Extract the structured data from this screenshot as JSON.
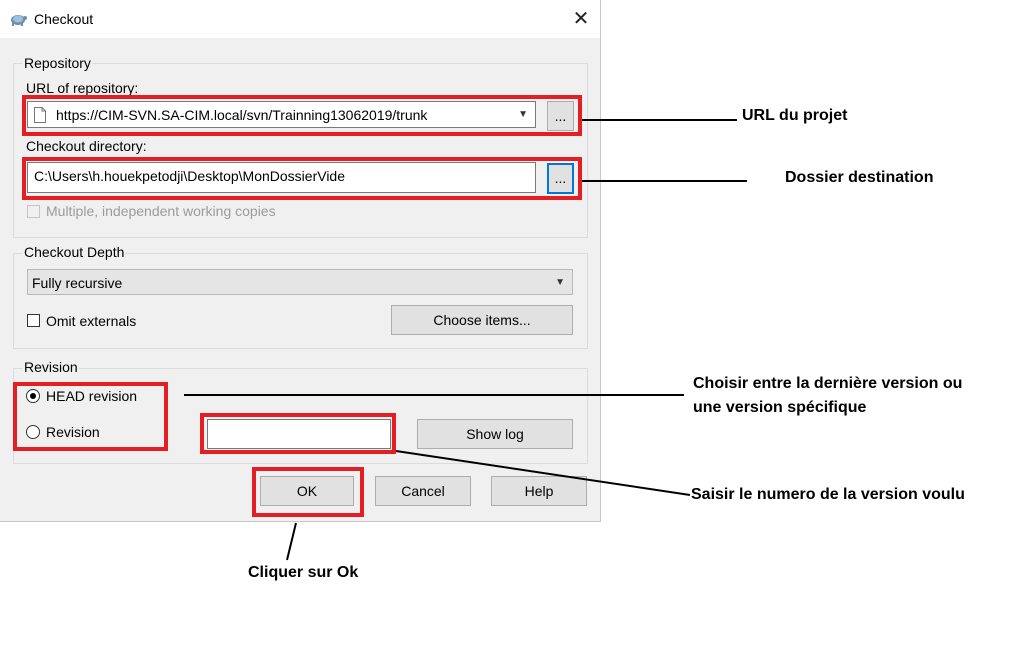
{
  "window": {
    "title": "Checkout",
    "close_glyph": "✕"
  },
  "repository": {
    "group_label": "Repository",
    "url_label": "URL of repository:",
    "url_value": "https://CIM-SVN.SA-CIM.local/svn/Trainning13062019/trunk",
    "browse_label": "...",
    "dir_label": "Checkout directory:",
    "dir_value": "C:\\Users\\h.houekpetodji\\Desktop\\MonDossierVide",
    "multiple_label": "Multiple, independent working copies"
  },
  "depth": {
    "group_label": "Checkout Depth",
    "selected": "Fully recursive",
    "omit_label": "Omit externals",
    "choose_label": "Choose items..."
  },
  "revision": {
    "group_label": "Revision",
    "head_label": "HEAD revision",
    "revision_label": "Revision",
    "revision_value": "",
    "showlog_label": "Show log"
  },
  "buttons": {
    "ok": "OK",
    "cancel": "Cancel",
    "help": "Help"
  },
  "annotations": {
    "url": "URL du projet",
    "dest": "Dossier destination",
    "choose_line1": "Choisir entre la dernière version ou",
    "choose_line2": "une version spécifique",
    "enter": "Saisir le numero de la version voulu",
    "click": "Cliquer sur Ok"
  },
  "colors": {
    "highlight": "#e31e24",
    "focus": "#0078d7",
    "dialog_bg": "#f0f0f0"
  }
}
